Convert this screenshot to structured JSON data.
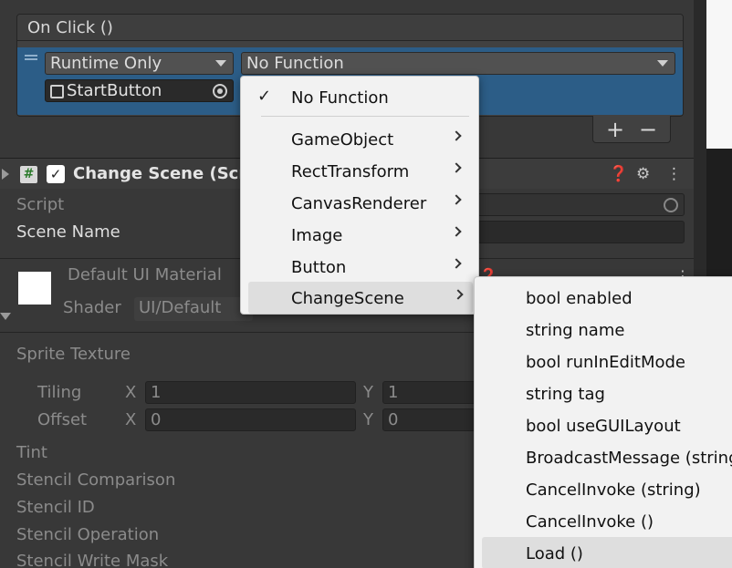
{
  "on_click": {
    "title": "On Click ()",
    "runtime_mode": "Runtime Only",
    "function": "No Function",
    "target_object": "StartButton",
    "add_label": "+",
    "remove_label": "−"
  },
  "change_scene": {
    "title": "Change Scene (Scrip",
    "enabled_check": "✓",
    "script_label": "Script",
    "scene_name_label": "Scene Name"
  },
  "material": {
    "title": "Default UI Material",
    "shader_label": "Shader",
    "shader_value": "UI/Default"
  },
  "material_props": {
    "sprite_texture": "Sprite Texture",
    "tiling": "Tiling",
    "offset": "Offset",
    "x_label": "X",
    "y_label": "Y",
    "tiling_x": "1",
    "tiling_y": "1",
    "offset_x": "0",
    "offset_y": "0",
    "tint": "Tint",
    "stencil_comparison": "Stencil Comparison",
    "stencil_id": "Stencil ID",
    "stencil_operation": "Stencil Operation",
    "stencil_write_mask": "Stencil Write Mask"
  },
  "function_menu": {
    "checkmark": "✓",
    "no_function": "No Function",
    "items": [
      "GameObject",
      "RectTransform",
      "CanvasRenderer",
      "Image",
      "Button",
      "ChangeScene"
    ]
  },
  "changescene_submenu": {
    "items": [
      "bool enabled",
      "string name",
      "bool runInEditMode",
      "string tag",
      "bool useGUILayout",
      "BroadcastMessage (string)",
      "CancelInvoke (string)",
      "CancelInvoke ()",
      "Load ()"
    ]
  },
  "colors": {
    "background": "#383838",
    "selection_blue": "#2c5d87",
    "menu_bg": "#f2f2f2",
    "menu_highlight": "#dedede"
  }
}
